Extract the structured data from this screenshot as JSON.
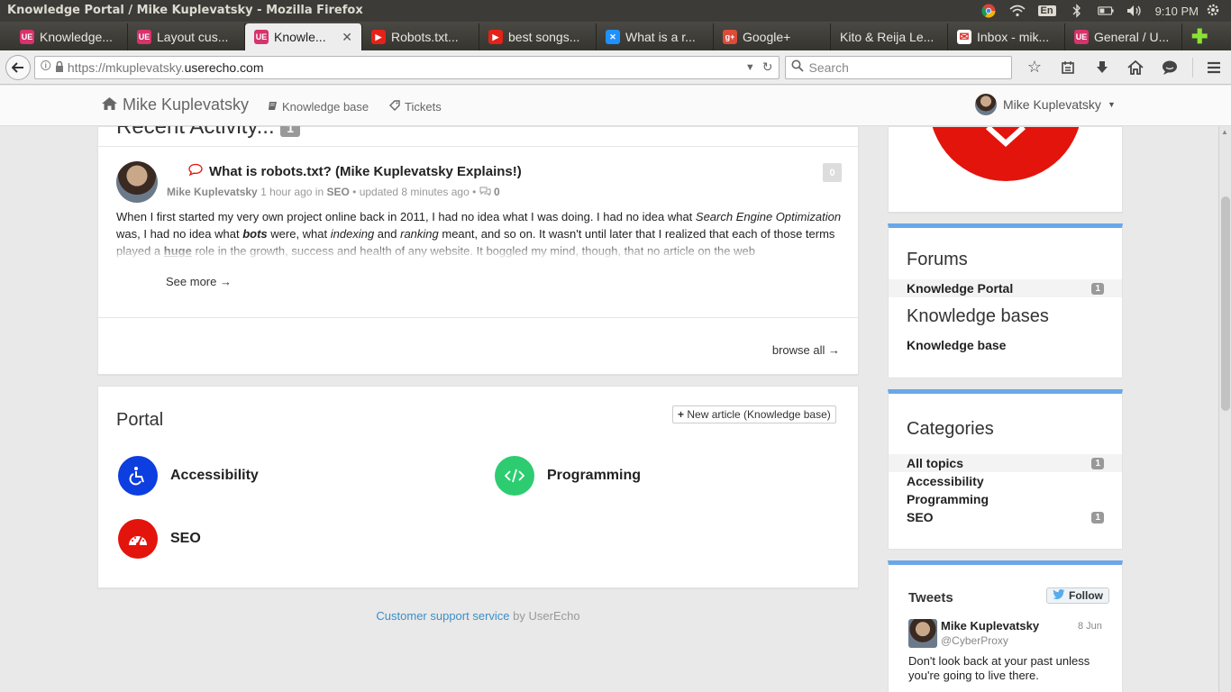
{
  "window": {
    "title": "Knowledge Portal / Mike Kuplevatsky - Mozilla Firefox",
    "lang": "En",
    "clock": "9:10 PM"
  },
  "tabs": [
    {
      "label": "Knowledge...",
      "icon": "userecho-icon",
      "color": "#d6336c",
      "glyph": "UE"
    },
    {
      "label": "Layout cus...",
      "icon": "userecho-icon",
      "color": "#d6336c",
      "glyph": "UE"
    },
    {
      "label": "Knowle...",
      "icon": "userecho-icon",
      "color": "#d6336c",
      "glyph": "UE",
      "active": true
    },
    {
      "label": "Robots.txt...",
      "icon": "youtube-icon",
      "color": "#e62117",
      "glyph": "▶"
    },
    {
      "label": "best songs...",
      "icon": "youtube-icon",
      "color": "#e62117",
      "glyph": "▶"
    },
    {
      "label": "What is a r...",
      "icon": "site-icon",
      "color": "#1e90ff",
      "glyph": "✕"
    },
    {
      "label": "Google+",
      "icon": "google-plus-icon",
      "color": "#dd4b39",
      "glyph": "g+"
    },
    {
      "label": "Kito & Reija Le...",
      "icon": "",
      "color": "",
      "glyph": ""
    },
    {
      "label": "Inbox - mik...",
      "icon": "gmail-icon",
      "color": "#ffffff",
      "glyph": "✉"
    },
    {
      "label": "General / U...",
      "icon": "userecho-icon",
      "color": "#d6336c",
      "glyph": "UE"
    }
  ],
  "nav": {
    "url_prefix": "https://mkuplevatsky.",
    "url_host": "userecho.com",
    "search_placeholder": "Search"
  },
  "site": {
    "brand": "Mike Kuplevatsky",
    "nav_kb": "Knowledge base",
    "nav_tickets": "Tickets",
    "user": "Mike Kuplevatsky"
  },
  "activity": {
    "heading": "Recent Activity...",
    "heading_count": "1",
    "post": {
      "title": "What is robots.txt? (Mike Kuplevatsky Explains!)",
      "author": "Mike Kuplevatsky",
      "time": "1 hour ago in",
      "category": "SEO",
      "updated": "• updated 8 minutes ago •",
      "comments": "0",
      "votes": "0",
      "body_1": "When I first started my very own project online back in 2011, I had no idea what I was doing. I had no idea what ",
      "body_em1": "Search Engine Optimization",
      "body_2": " was, I had no idea what ",
      "body_b1": "bots",
      "body_3": " were, what ",
      "body_em2": "indexing",
      "body_4": " and ",
      "body_em3": "ranking",
      "body_5": " meant, and so on. It wasn't until later that I realized that each of those terms played a ",
      "body_b2": "huge",
      "body_6": " role in the growth, success and health of any website. It boggled my mind, though, that no article on the web"
    },
    "see_more": "See more →",
    "browse_all": "browse all →"
  },
  "portal": {
    "title": "Portal",
    "new_article": "New article (Knowledge base)",
    "categories": [
      {
        "label": "Accessibility",
        "icon": "wheelchair-icon",
        "color": "#0d3ee0"
      },
      {
        "label": "Programming",
        "icon": "code-icon",
        "color": "#2ecc71"
      },
      {
        "label": "SEO",
        "icon": "dashboard-icon",
        "color": "#e3140c"
      }
    ]
  },
  "footer": {
    "link": "Customer support service",
    "by": "by UserEcho"
  },
  "sidebar": {
    "forums_title": "Forums",
    "forums": [
      {
        "label": "Knowledge Portal",
        "count": "1"
      }
    ],
    "kb_title": "Knowledge bases",
    "kbs": [
      {
        "label": "Knowledge base"
      }
    ],
    "categories_title": "Categories",
    "categories": [
      {
        "label": "All topics",
        "count": "1"
      },
      {
        "label": "Accessibility",
        "count": ""
      },
      {
        "label": "Programming",
        "count": ""
      },
      {
        "label": "SEO",
        "count": "1"
      }
    ],
    "tweets": {
      "title": "Tweets",
      "follow": "Follow",
      "name": "Mike Kuplevatsky",
      "handle": "@CyberProxy",
      "date": "8 Jun",
      "text": "Don't look back at your past unless you're going to live there."
    }
  }
}
